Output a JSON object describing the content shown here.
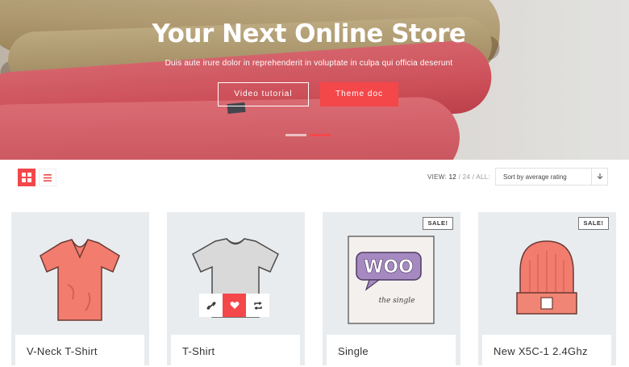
{
  "hero": {
    "title": "Your Next Online Store",
    "subtitle": "Duis aute irure dolor in reprehenderit in voluptate in culpa qui officia deserunt",
    "buttons": {
      "video": "Video tutorial",
      "theme": "Theme doc"
    },
    "accent": "#f4474a",
    "slides": 2,
    "active_slide": 2
  },
  "toolbar": {
    "view_label": "VIEW:",
    "view_options": [
      "12",
      "24",
      "ALL"
    ],
    "view_selected": "12",
    "sort_value": "Sort by average rating",
    "grid_icon": "grid-icon",
    "list_icon": "list-icon"
  },
  "products": [
    {
      "title": "V-Neck T-Shirt",
      "sale": false,
      "art": "red-tshirt"
    },
    {
      "title": "T-Shirt",
      "sale": false,
      "art": "grey-tshirt",
      "hover_actions": [
        "link-icon",
        "heart-icon",
        "compare-icon"
      ]
    },
    {
      "title": "Single",
      "sale": true,
      "sale_label": "SALE!",
      "art": "woo-album",
      "art_text": [
        "WOO",
        "the single"
      ]
    },
    {
      "title": "New X5C-1 2.4Ghz",
      "sale": true,
      "sale_label": "SALE!",
      "art": "red-beanie"
    }
  ]
}
